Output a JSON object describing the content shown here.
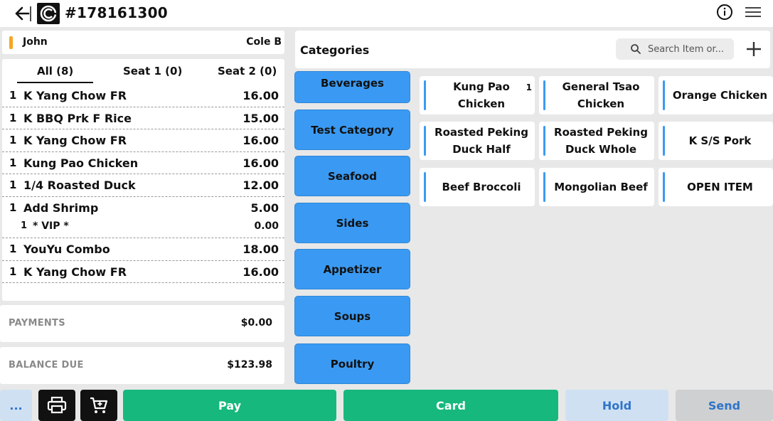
{
  "header": {
    "order_number": "#178161300"
  },
  "customer": {
    "name": "John",
    "server": "Cole B"
  },
  "seat_tabs": [
    {
      "label": "All (8)",
      "active": true
    },
    {
      "label": "Seat 1 (0)",
      "active": false
    },
    {
      "label": "Seat 2 (0)",
      "active": false
    }
  ],
  "order_items": [
    {
      "qty": "1",
      "name": "K Yang Chow FR",
      "price": "16.00"
    },
    {
      "qty": "1",
      "name": "K BBQ Prk F Rice",
      "price": "15.00"
    },
    {
      "qty": "1",
      "name": "K Yang Chow FR",
      "price": "16.00"
    },
    {
      "qty": "1",
      "name": "Kung Pao Chicken",
      "price": "16.00"
    },
    {
      "qty": "1",
      "name": "1/4 Roasted Duck",
      "price": "12.00"
    },
    {
      "qty": "1",
      "name": "Add Shrimp",
      "price": "5.00"
    },
    {
      "qty": "1",
      "name": "* VIP *",
      "price": "0.00",
      "modifier": true
    },
    {
      "qty": "1",
      "name": "YouYu Combo",
      "price": "18.00"
    },
    {
      "qty": "1",
      "name": "K Yang Chow FR",
      "price": "16.00"
    }
  ],
  "payments": {
    "label": "PAYMENTS",
    "value": "$0.00"
  },
  "balance": {
    "label": "BALANCE DUE",
    "value": "$123.98"
  },
  "categories_panel": {
    "title": "Categories",
    "search_placeholder": "Search Item or..."
  },
  "categories": [
    "Beverages",
    "Test Category",
    "Seafood",
    "Sides",
    "Appetizer",
    "Soups",
    "Poultry"
  ],
  "menu_items": [
    {
      "label": "Kung Pao Chicken",
      "count": "1"
    },
    {
      "label": "General Tsao Chicken"
    },
    {
      "label": "Orange Chicken"
    },
    {
      "label": "Roasted Peking Duck Half"
    },
    {
      "label": "Roasted Peking Duck Whole"
    },
    {
      "label": "K S/S Pork"
    },
    {
      "label": "Beef Broccoli"
    },
    {
      "label": "Mongolian Beef"
    },
    {
      "label": "OPEN ITEM"
    }
  ],
  "actions": {
    "more": "...",
    "pay": "Pay",
    "card": "Card",
    "hold": "Hold",
    "send": "Send"
  },
  "colors": {
    "category_blue": "#3a9af3",
    "pay_green": "#16b87d",
    "accent_orange": "#f5a623",
    "hold_text": "#2f74c8"
  },
  "icons": {
    "back": "arrow-left-icon",
    "logo": "brand-logo-icon",
    "info": "info-icon",
    "menu": "hamburger-menu-icon",
    "search": "search-icon",
    "add": "plus-icon",
    "print": "printer-icon",
    "cart": "cart-icon"
  }
}
